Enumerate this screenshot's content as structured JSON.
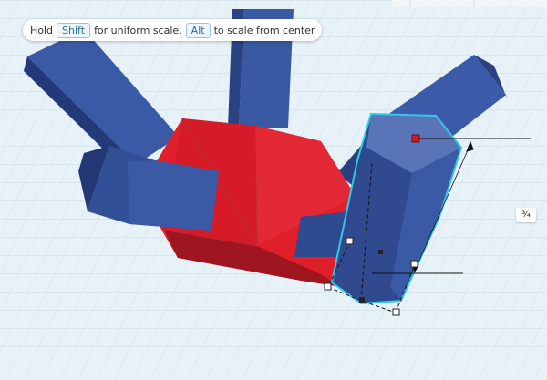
{
  "hint": {
    "text_hold": "Hold",
    "key_shift": "Shift",
    "text_uniform": "for uniform scale.",
    "key_alt": "Alt",
    "text_center": "to scale from center"
  },
  "dimension_label": "¾",
  "colors": {
    "grid_background": "#e7f1f8",
    "grid_line": "#c9dbe8",
    "shape_blue": "#2f4c8e",
    "shape_red": "#d81f2a",
    "selection_outline": "#34c6e8",
    "handle_red": "#d11b1b"
  }
}
